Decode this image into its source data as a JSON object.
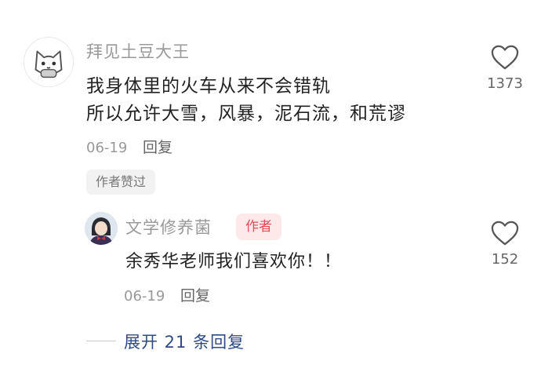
{
  "main_comment": {
    "username": "拜见土豆大王",
    "lines": [
      "我身体里的火车从来不会错轨",
      "所以允许大雪，风暴，泥石流，和荒谬"
    ],
    "date": "06-19",
    "reply_label": "回复",
    "author_liked_label": "作者赞过",
    "like_count": "1373",
    "like_icon": "heart-outline-icon",
    "avatar_icon": "cat-avatar-icon"
  },
  "reply": {
    "username": "文学修养菌",
    "author_tag": "作者",
    "text": "余秀华老师我们喜欢你！！",
    "date": "06-19",
    "reply_label": "回复",
    "like_count": "152",
    "like_icon": "heart-outline-icon"
  },
  "expand": {
    "label": "展开 21 条回复"
  },
  "colors": {
    "username": "#999999",
    "body_text": "#222222",
    "author_tag_bg": "#fde9ea",
    "author_tag_text": "#e84a5a",
    "expand_link": "#2f4a87"
  }
}
